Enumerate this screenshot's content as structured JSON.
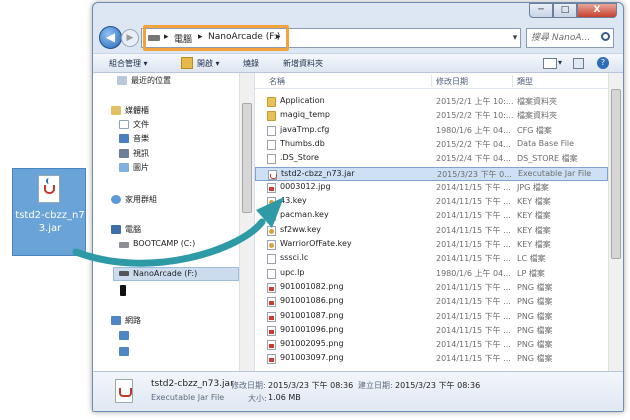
{
  "desktop_icon": {
    "label": "tstd2-cbzz_n73.jar"
  },
  "window": {
    "caption": {
      "minimize": "─",
      "maximize": "□",
      "close": "X"
    },
    "address": {
      "crumbs": [
        "電腦",
        "NanoArcade (F:)"
      ],
      "separator": "▸",
      "dropdown": "▾",
      "refresh": "↻"
    },
    "search": {
      "placeholder": "搜尋 NanoA..."
    },
    "toolbar": {
      "organize": "組合管理 ▾",
      "open": "開啟 ▾",
      "burn": "燒錄",
      "new_folder": "新增資料夾"
    },
    "nav": {
      "items": [
        {
          "label": "最近的位置",
          "icon": "recent-places-icon"
        },
        {
          "label": "媒體櫃",
          "icon": "library-icon"
        },
        {
          "label": "文件",
          "icon": "documents-icon"
        },
        {
          "label": "音樂",
          "icon": "music-icon"
        },
        {
          "label": "視訊",
          "icon": "videos-icon"
        },
        {
          "label": "圖片",
          "icon": "pictures-icon"
        },
        {
          "label": "家用群組",
          "icon": "homegroup-icon"
        },
        {
          "label": "電腦",
          "icon": "computer-icon"
        },
        {
          "label": "BOOTCAMP (C:)",
          "icon": "drive-icon"
        },
        {
          "label": "NanoArcade (F:)",
          "icon": "drive-icon"
        },
        {
          "label": "網路",
          "icon": "network-icon"
        }
      ]
    },
    "columns": {
      "name": "名稱",
      "date": "修改日期",
      "type": "類型"
    },
    "files": [
      {
        "name": "Application",
        "date": "2015/2/1 上午 10:...",
        "type": "檔案資料夾",
        "icon": "folder"
      },
      {
        "name": "magiq_temp",
        "date": "2015/2/2 下午 10:...",
        "type": "檔案資料夾",
        "icon": "folder"
      },
      {
        "name": "javaTmp.cfg",
        "date": "1980/1/6 上午 04...",
        "type": "CFG 檔案",
        "icon": "doc"
      },
      {
        "name": "Thumbs.db",
        "date": "2015/2/2 下午 04...",
        "type": "Data Base File",
        "icon": "doc"
      },
      {
        "name": ".DS_Store",
        "date": "2015/2/4 下午 04...",
        "type": "DS_STORE 檔案",
        "icon": "doc"
      },
      {
        "name": "tstd2-cbzz_n73.jar",
        "date": "2015/3/23 下午 0...",
        "type": "Executable Jar File",
        "icon": "jar"
      },
      {
        "name": "0003012.jpg",
        "date": "2014/11/15 下午 ...",
        "type": "JPG 檔案",
        "icon": "img"
      },
      {
        "name": "43.key",
        "date": "2014/11/15 下午 ...",
        "type": "KEY 檔案",
        "icon": "key"
      },
      {
        "name": "pacman.key",
        "date": "2014/11/15 下午 ...",
        "type": "KEY 檔案",
        "icon": "key"
      },
      {
        "name": "sf2ww.key",
        "date": "2014/11/15 下午 ...",
        "type": "KEY 檔案",
        "icon": "key"
      },
      {
        "name": "WarriorOfFate.key",
        "date": "2014/11/15 下午 ...",
        "type": "KEY 檔案",
        "icon": "key"
      },
      {
        "name": "sssci.lc",
        "date": "2014/11/15 下午 ...",
        "type": "LC 檔案",
        "icon": "doc"
      },
      {
        "name": "upc.lp",
        "date": "1980/1/6 上午 04...",
        "type": "LP 檔案",
        "icon": "doc"
      },
      {
        "name": "901001082.png",
        "date": "2014/11/15 下午 ...",
        "type": "PNG 檔案",
        "icon": "img"
      },
      {
        "name": "901001086.png",
        "date": "2014/11/15 下午 ...",
        "type": "PNG 檔案",
        "icon": "img"
      },
      {
        "name": "901001087.png",
        "date": "2014/11/15 下午 ...",
        "type": "PNG 檔案",
        "icon": "img"
      },
      {
        "name": "901001096.png",
        "date": "2014/11/15 下午 ...",
        "type": "PNG 檔案",
        "icon": "img"
      },
      {
        "name": "901002095.png",
        "date": "2014/11/15 下午 ...",
        "type": "PNG 檔案",
        "icon": "img"
      },
      {
        "name": "901003097.png",
        "date": "2014/11/15 下午 ...",
        "type": "PNG 檔案",
        "icon": "img"
      }
    ],
    "details": {
      "name": "tstd2-cbzz_n73.jar",
      "type": "Executable Jar File",
      "modified_label": "修改日期:",
      "modified": "2015/3/23 下午 08:36",
      "created_label": "建立日期:",
      "created": "2015/3/23 下午 08:36",
      "size_label": "大小:",
      "size": "1.06 MB"
    }
  },
  "colors": {
    "arrow": "#2e9aa6",
    "highlight": "#f4a23c",
    "selection": "#cde0f5"
  }
}
